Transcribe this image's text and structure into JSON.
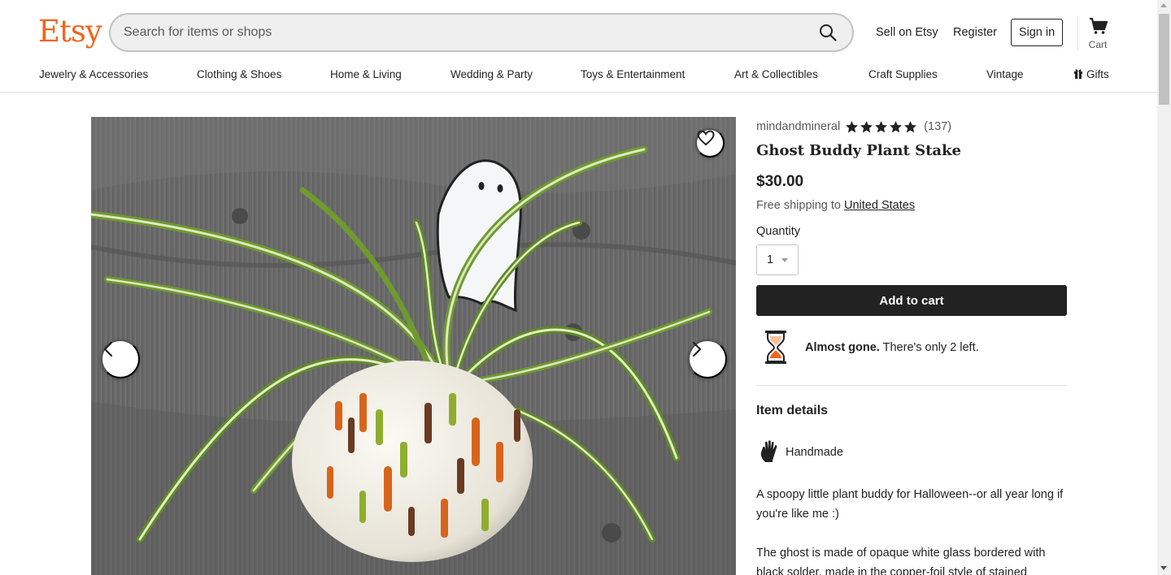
{
  "header": {
    "logo": "Etsy",
    "search_placeholder": "Search for items or shops",
    "sell_label": "Sell on Etsy",
    "register_label": "Register",
    "signin_label": "Sign in",
    "cart_label": "Cart"
  },
  "categories": [
    "Jewelry & Accessories",
    "Clothing & Shoes",
    "Home & Living",
    "Wedding & Party",
    "Toys & Entertainment",
    "Art & Collectibles",
    "Craft Supplies",
    "Vintage",
    "Gifts"
  ],
  "product": {
    "shop_name": "mindandmineral",
    "rating_stars": 5,
    "review_count": "(137)",
    "title": "Ghost Buddy Plant Stake",
    "price": "$30.00",
    "shipping_prefix": "Free shipping to",
    "shipping_destination": "United States",
    "quantity_label": "Quantity",
    "quantity_value": "1",
    "add_to_cart_label": "Add to cart",
    "stock_bold": "Almost gone.",
    "stock_rest": "There's only 2 left.",
    "details_heading": "Item details",
    "handmade_label": "Handmade",
    "description_1": "A spoopy little plant buddy for Halloween--or all year long if you're like me :)",
    "description_2": "The ghost is made of opaque white glass bordered with black solder, made in the copper-foil style of stained"
  },
  "colors": {
    "brand": "#f1641e",
    "button_dark": "#222222",
    "muted_text": "#595959"
  },
  "icons": {
    "search": "search-icon",
    "cart": "cart-icon",
    "gift": "gift-icon",
    "heart": "heart-icon",
    "prev": "chevron-left-icon",
    "next": "chevron-right-icon",
    "star": "star-icon",
    "hourglass": "hourglass-icon",
    "hand": "hand-icon"
  }
}
